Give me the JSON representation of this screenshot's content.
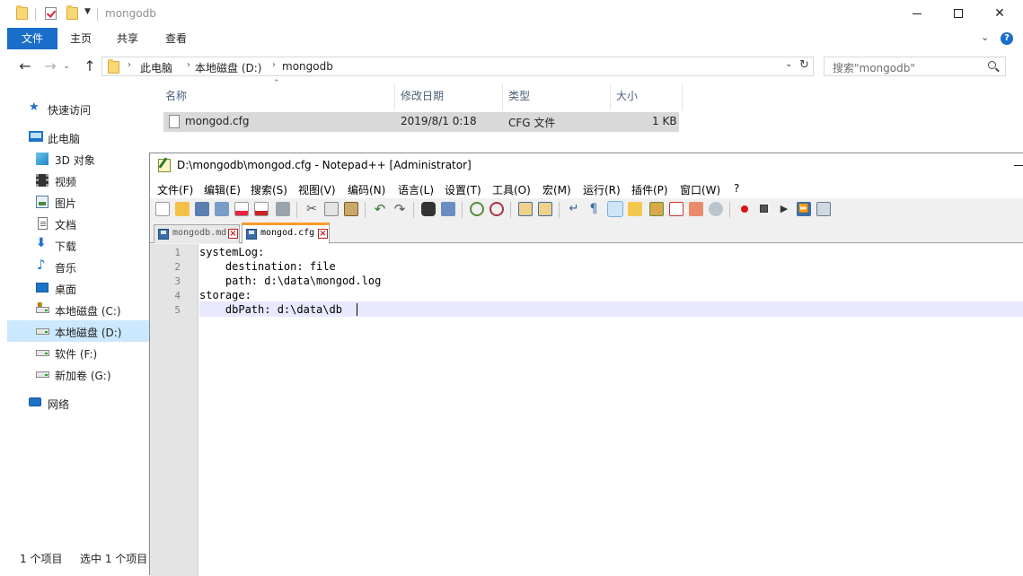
{
  "explorer": {
    "title": "mongodb",
    "ribbon_tabs": [
      "文件",
      "主页",
      "共享",
      "查看"
    ],
    "address": {
      "crumbs": [
        "此电脑",
        "本地磁盘 (D:)",
        "mongodb"
      ]
    },
    "search_placeholder": "搜索\"mongodb\"",
    "sidebar": {
      "items": [
        {
          "label": "快速访问",
          "icon": "star-icon"
        },
        {
          "label": "此电脑",
          "icon": "computer-icon"
        },
        {
          "label": "3D 对象",
          "icon": "cube-icon"
        },
        {
          "label": "视频",
          "icon": "video-icon"
        },
        {
          "label": "图片",
          "icon": "picture-icon"
        },
        {
          "label": "文档",
          "icon": "document-icon"
        },
        {
          "label": "下载",
          "icon": "download-icon"
        },
        {
          "label": "音乐",
          "icon": "music-icon"
        },
        {
          "label": "桌面",
          "icon": "desktop-icon"
        },
        {
          "label": "本地磁盘 (C:)",
          "icon": "drive-icon"
        },
        {
          "label": "本地磁盘 (D:)",
          "icon": "drive-icon",
          "selected": true
        },
        {
          "label": "软件 (F:)",
          "icon": "drive-icon"
        },
        {
          "label": "新加卷 (G:)",
          "icon": "drive-icon"
        },
        {
          "label": "网络",
          "icon": "network-icon"
        }
      ]
    },
    "columns": [
      "名称",
      "修改日期",
      "类型",
      "大小"
    ],
    "files": [
      {
        "name": "mongod.cfg",
        "modified": "2019/8/1 0:18",
        "type": "CFG 文件",
        "size": "1 KB"
      }
    ],
    "status": {
      "count": "1 个项目",
      "selected": "选中 1 个项目"
    }
  },
  "notepad": {
    "title": "D:\\mongodb\\mongod.cfg - Notepad++ [Administrator]",
    "menu": [
      "文件(F)",
      "编辑(E)",
      "搜索(S)",
      "视图(V)",
      "编码(N)",
      "语言(L)",
      "设置(T)",
      "工具(O)",
      "宏(M)",
      "运行(R)",
      "插件(P)",
      "窗口(W)",
      "?"
    ],
    "tabs": [
      {
        "label": "mongodb.md",
        "active": false
      },
      {
        "label": "mongod.cfg",
        "active": true
      }
    ],
    "lines": [
      {
        "num": "1",
        "text": "systemLog:"
      },
      {
        "num": "2",
        "text": "    destination: file"
      },
      {
        "num": "3",
        "text": "    path: d:\\data\\mongod.log"
      },
      {
        "num": "4",
        "text": "storage:"
      },
      {
        "num": "5",
        "text": "    dbPath: d:\\data\\db"
      }
    ]
  },
  "colors": {
    "accent": "#1a6ec9",
    "selected_nav": "#cce8ff",
    "active_tab_border": "#fa9b28",
    "current_line": "#e8e8ff"
  }
}
